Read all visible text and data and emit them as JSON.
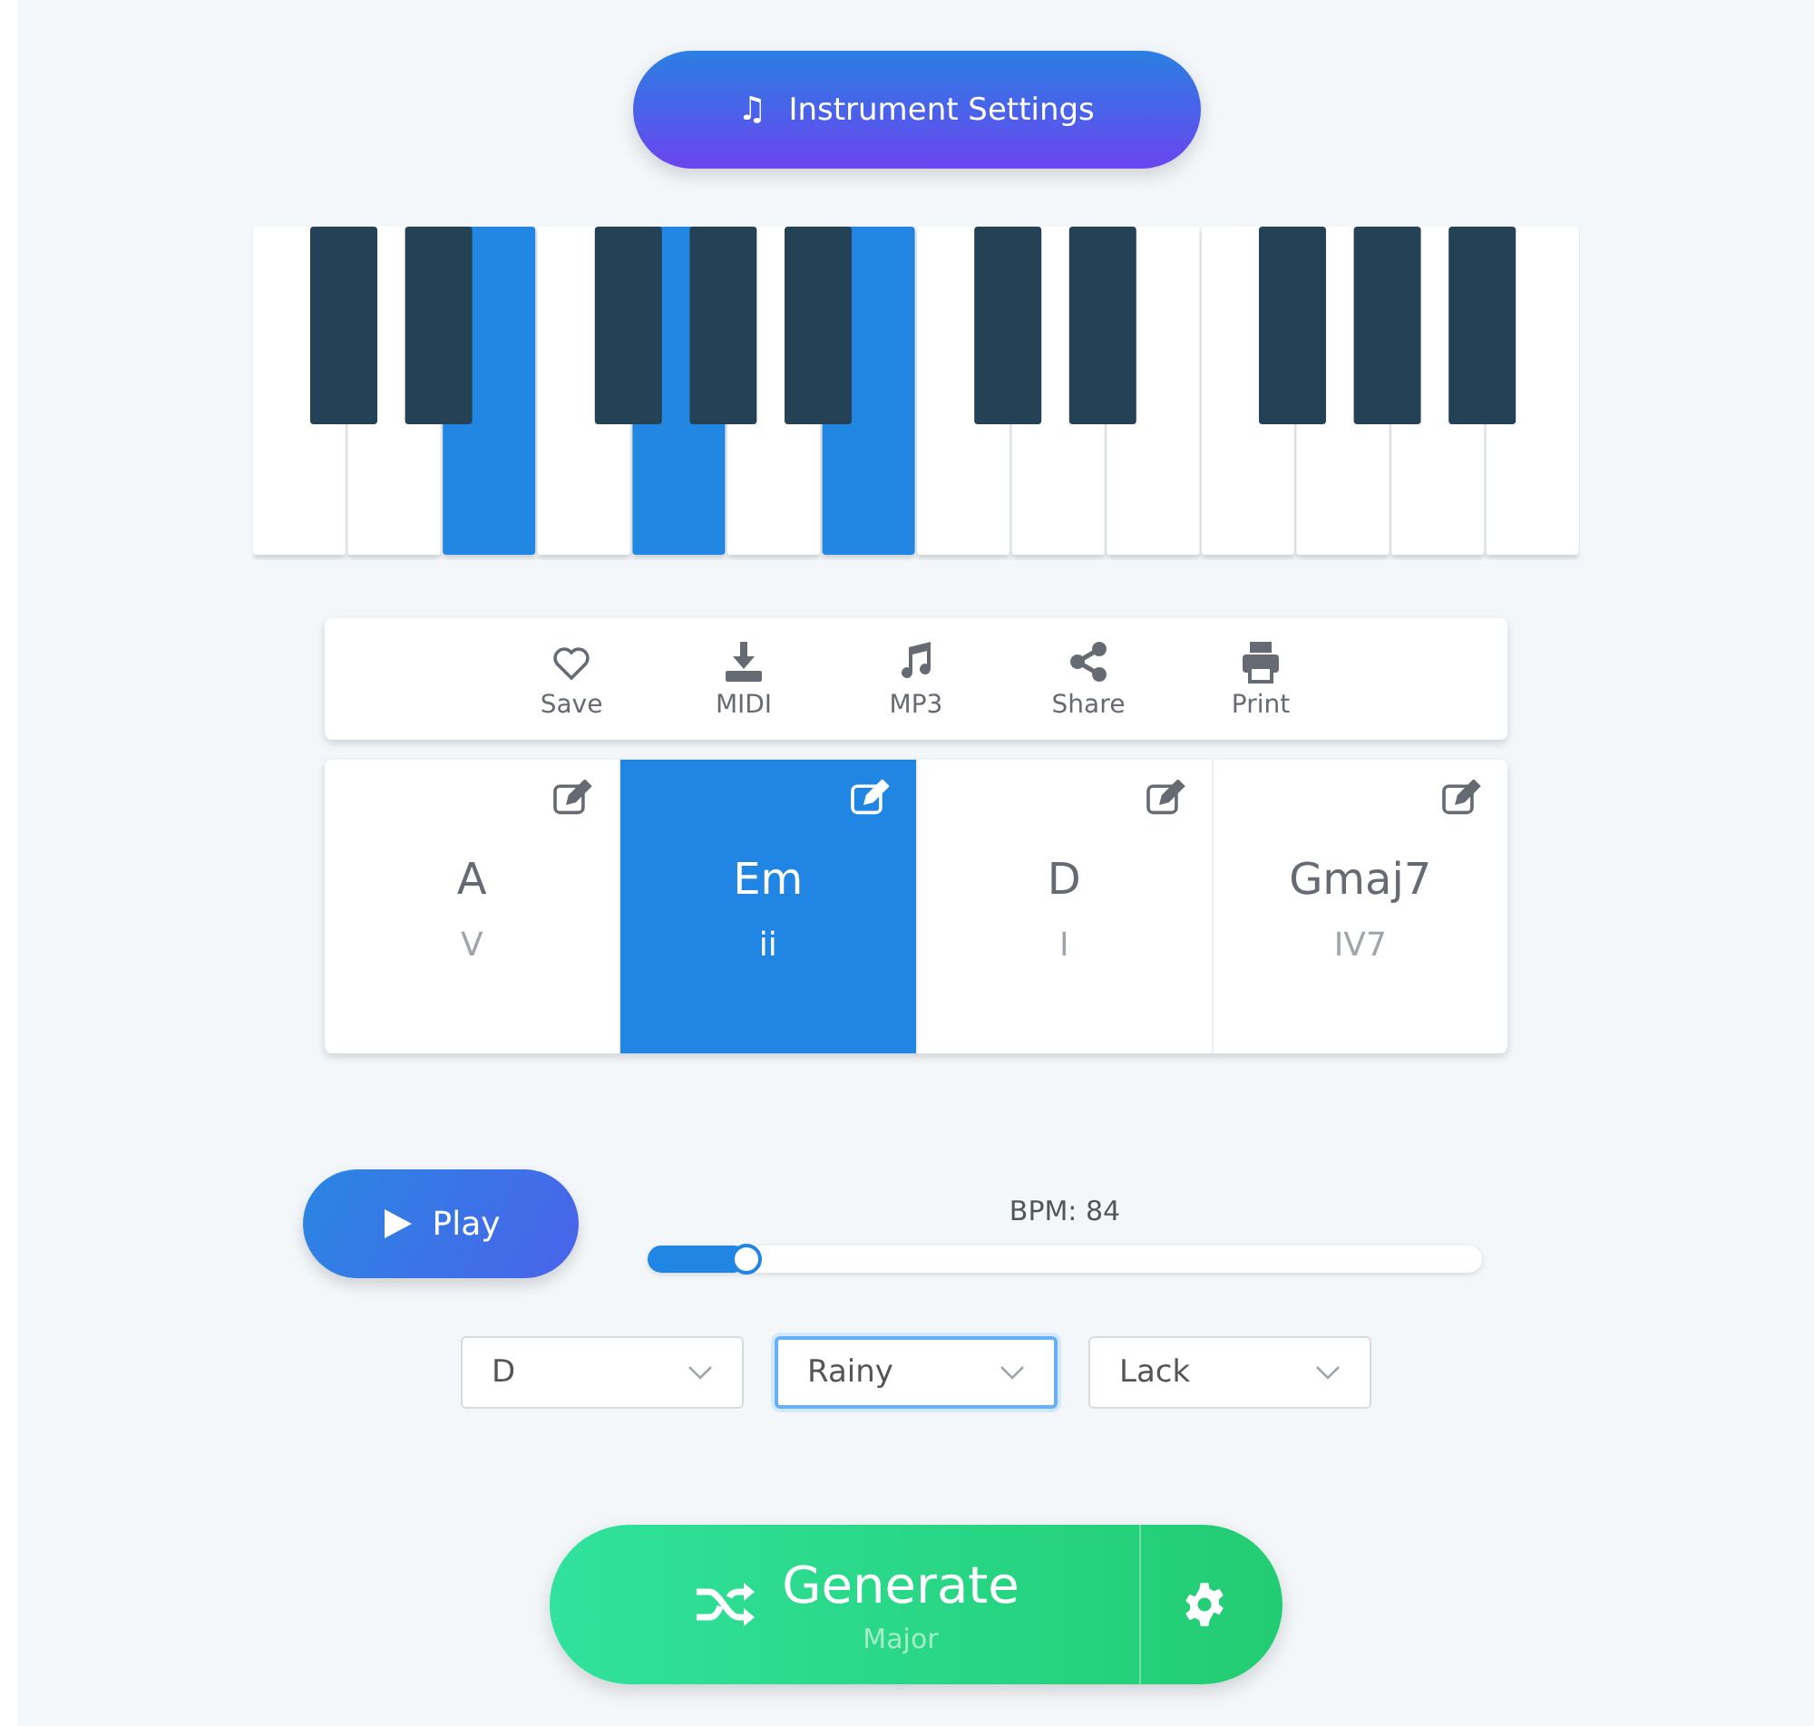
{
  "instrument_button": {
    "icon": "♫",
    "label": "Instrument Settings"
  },
  "keyboard": {
    "white_keys": [
      {
        "selected": false,
        "sharp": true
      },
      {
        "selected": false,
        "sharp": true
      },
      {
        "selected": true,
        "sharp": false
      },
      {
        "selected": false,
        "sharp": true
      },
      {
        "selected": true,
        "sharp": true
      },
      {
        "selected": false,
        "sharp": true
      },
      {
        "selected": true,
        "sharp": false
      },
      {
        "selected": false,
        "sharp": true
      },
      {
        "selected": false,
        "sharp": true
      },
      {
        "selected": false,
        "sharp": false
      },
      {
        "selected": false,
        "sharp": true
      },
      {
        "selected": false,
        "sharp": true
      },
      {
        "selected": false,
        "sharp": true
      },
      {
        "selected": false,
        "sharp": false
      }
    ]
  },
  "toolbar": [
    {
      "kind": "heart",
      "label": "Save"
    },
    {
      "kind": "download",
      "label": "MIDI"
    },
    {
      "kind": "note",
      "label": "MP3"
    },
    {
      "kind": "share",
      "label": "Share"
    },
    {
      "kind": "print",
      "label": "Print"
    }
  ],
  "chords": [
    {
      "name": "A",
      "numeral": "V",
      "selected": false
    },
    {
      "name": "Em",
      "numeral": "ii",
      "selected": true
    },
    {
      "name": "D",
      "numeral": "I",
      "selected": false
    },
    {
      "name": "Gmaj7",
      "numeral": "IV7",
      "selected": false
    }
  ],
  "play_button": {
    "label": "Play"
  },
  "tempo": {
    "label": "BPM: 84",
    "level": 0.12
  },
  "selects": [
    {
      "value": "D",
      "focused": false
    },
    {
      "value": "Rainy",
      "focused": true
    },
    {
      "value": "Lack",
      "focused": false
    }
  ],
  "generate_button": {
    "label": "Generate",
    "sublabel": "Major"
  }
}
